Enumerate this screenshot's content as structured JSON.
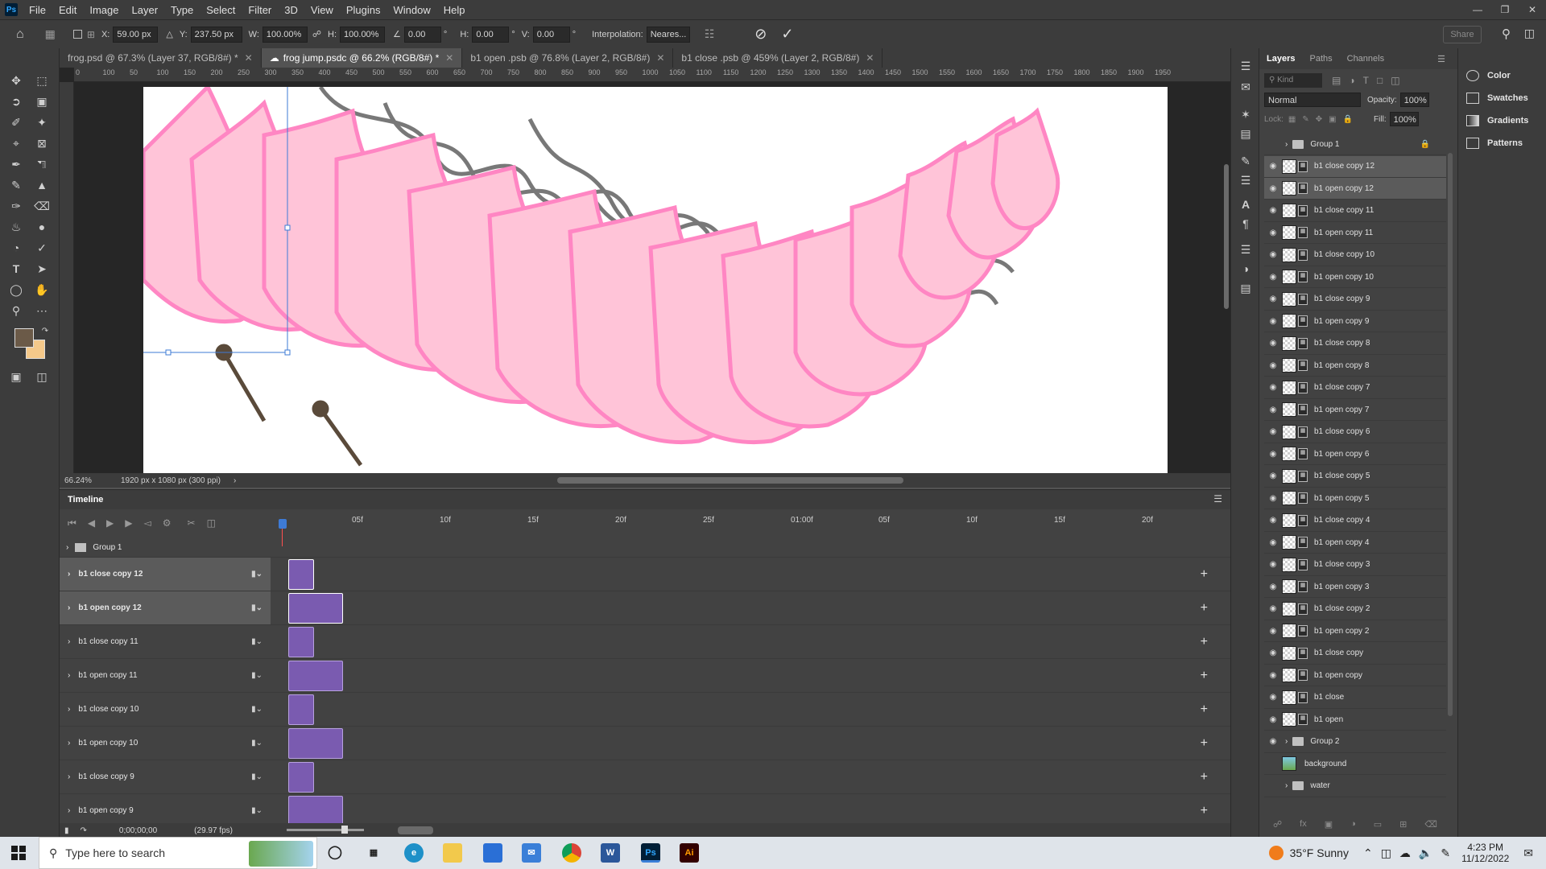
{
  "menubar": {
    "items": [
      "File",
      "Edit",
      "Image",
      "Layer",
      "Type",
      "Select",
      "Filter",
      "3D",
      "View",
      "Plugins",
      "Window",
      "Help"
    ]
  },
  "options": {
    "x_label": "X:",
    "x_value": "59.00 px",
    "y_label": "Y:",
    "y_value": "237.50 px",
    "w_label": "W:",
    "w_value": "100.00%",
    "h_label": "H:",
    "h_value": "100.00%",
    "angle_value": "0.00",
    "angle_unit": "°",
    "hskew_label": "H:",
    "hskew_value": "0.00",
    "vskew_label": "V:",
    "vskew_value": "0.00",
    "interp_label": "Interpolation:",
    "interp_value": "Neares...",
    "share": "Share"
  },
  "tabs": [
    {
      "label": "frog.psd @ 67.3% (Layer 37, RGB/8#) *"
    },
    {
      "label": "frog jump.psdc @ 66.2% (RGB/8#) *"
    },
    {
      "label": "b1 open .psb @ 76.8% (Layer 2, RGB/8#)"
    },
    {
      "label": "b1 close .psb @ 459% (Layer 2, RGB/8#)"
    }
  ],
  "ruler": [
    "0",
    "100",
    "50",
    "100",
    "150",
    "200",
    "250",
    "300",
    "350",
    "400",
    "450",
    "500",
    "550",
    "600",
    "650",
    "700",
    "750",
    "800",
    "850",
    "900",
    "950",
    "1000",
    "1050",
    "1100",
    "1150",
    "1200",
    "1250",
    "1300",
    "1350",
    "1400",
    "1450",
    "1500",
    "1550",
    "1600",
    "1650",
    "1700",
    "1750",
    "1800",
    "1850",
    "1900",
    "1950"
  ],
  "status": {
    "zoom": "66.24%",
    "dims": "1920 px x 1080 px (300 ppi)"
  },
  "timeline": {
    "title": "Timeline",
    "ruler": [
      "05f",
      "10f",
      "15f",
      "20f",
      "25f",
      "01:00f",
      "05f",
      "10f",
      "15f",
      "20f"
    ],
    "group": "Group 1",
    "tracks": [
      {
        "label": "b1 close  copy 12",
        "selected": true
      },
      {
        "label": "b1 open  copy 12",
        "selected": true
      },
      {
        "label": "b1 close  copy 11",
        "selected": false
      },
      {
        "label": "b1 open  copy 11",
        "selected": false
      },
      {
        "label": "b1 close  copy 10",
        "selected": false
      },
      {
        "label": "b1 open  copy 10",
        "selected": false
      },
      {
        "label": "b1 close  copy 9",
        "selected": false
      },
      {
        "label": "b1 open  copy 9",
        "selected": false
      }
    ],
    "timecode": "0;00;00;00",
    "fps": "(29.97 fps)"
  },
  "layers": {
    "tabs": [
      "Layers",
      "Paths",
      "Channels"
    ],
    "kind": "Kind",
    "blend": "Normal",
    "opacity_label": "Opacity:",
    "opacity": "100%",
    "lock_label": "Lock:",
    "fill_label": "Fill:",
    "fill": "100%",
    "rows": [
      {
        "label": "Group 1",
        "type": "group",
        "visible": false,
        "selected": false
      },
      {
        "label": "b1 close  copy 12",
        "type": "smart",
        "visible": true,
        "selected": true
      },
      {
        "label": "b1 open  copy 12",
        "type": "smart",
        "visible": true,
        "selected": true
      },
      {
        "label": "b1 close  copy 11",
        "type": "smart",
        "visible": true,
        "selected": false
      },
      {
        "label": "b1 open  copy 11",
        "type": "smart",
        "visible": true,
        "selected": false
      },
      {
        "label": "b1 close  copy 10",
        "type": "smart",
        "visible": true,
        "selected": false
      },
      {
        "label": "b1 open  copy 10",
        "type": "smart",
        "visible": true,
        "selected": false
      },
      {
        "label": "b1 close  copy 9",
        "type": "smart",
        "visible": true,
        "selected": false
      },
      {
        "label": "b1 open  copy 9",
        "type": "smart",
        "visible": true,
        "selected": false
      },
      {
        "label": "b1 close  copy 8",
        "type": "smart",
        "visible": true,
        "selected": false
      },
      {
        "label": "b1 open  copy 8",
        "type": "smart",
        "visible": true,
        "selected": false
      },
      {
        "label": "b1 close  copy 7",
        "type": "smart",
        "visible": true,
        "selected": false
      },
      {
        "label": "b1 open  copy 7",
        "type": "smart",
        "visible": true,
        "selected": false
      },
      {
        "label": "b1 close  copy 6",
        "type": "smart",
        "visible": true,
        "selected": false
      },
      {
        "label": "b1 open  copy 6",
        "type": "smart",
        "visible": true,
        "selected": false
      },
      {
        "label": "b1 close  copy 5",
        "type": "smart",
        "visible": true,
        "selected": false
      },
      {
        "label": "b1 open  copy 5",
        "type": "smart",
        "visible": true,
        "selected": false
      },
      {
        "label": "b1 close  copy 4",
        "type": "smart",
        "visible": true,
        "selected": false
      },
      {
        "label": "b1 open  copy 4",
        "type": "smart",
        "visible": true,
        "selected": false
      },
      {
        "label": "b1 close  copy 3",
        "type": "smart",
        "visible": true,
        "selected": false
      },
      {
        "label": "b1 open  copy 3",
        "type": "smart",
        "visible": true,
        "selected": false
      },
      {
        "label": "b1 close  copy 2",
        "type": "smart",
        "visible": true,
        "selected": false
      },
      {
        "label": "b1 open  copy 2",
        "type": "smart",
        "visible": true,
        "selected": false
      },
      {
        "label": "b1 close  copy",
        "type": "smart",
        "visible": true,
        "selected": false
      },
      {
        "label": "b1 open  copy",
        "type": "smart",
        "visible": true,
        "selected": false
      },
      {
        "label": "b1 close",
        "type": "smart",
        "visible": true,
        "selected": false
      },
      {
        "label": "b1 open",
        "type": "smart",
        "visible": true,
        "selected": false
      },
      {
        "label": "Group 2",
        "type": "group",
        "visible": true,
        "selected": false
      },
      {
        "label": "background",
        "type": "image",
        "visible": false,
        "selected": false
      },
      {
        "label": "water",
        "type": "group",
        "visible": false,
        "selected": false
      }
    ]
  },
  "minipanels": [
    "Color",
    "Swatches",
    "Gradients",
    "Patterns"
  ],
  "taskbar": {
    "search_placeholder": "Type here to search",
    "weather": "35°F  Sunny",
    "time": "4:23 PM",
    "date": "11/12/2022"
  },
  "colors": {
    "fg_swatch": "#6b5a48",
    "bg_swatch": "#f5c98a",
    "pink": "#ffb6cf",
    "pink_stroke": "#ff7fbf",
    "clip": "#7a5bb0"
  }
}
